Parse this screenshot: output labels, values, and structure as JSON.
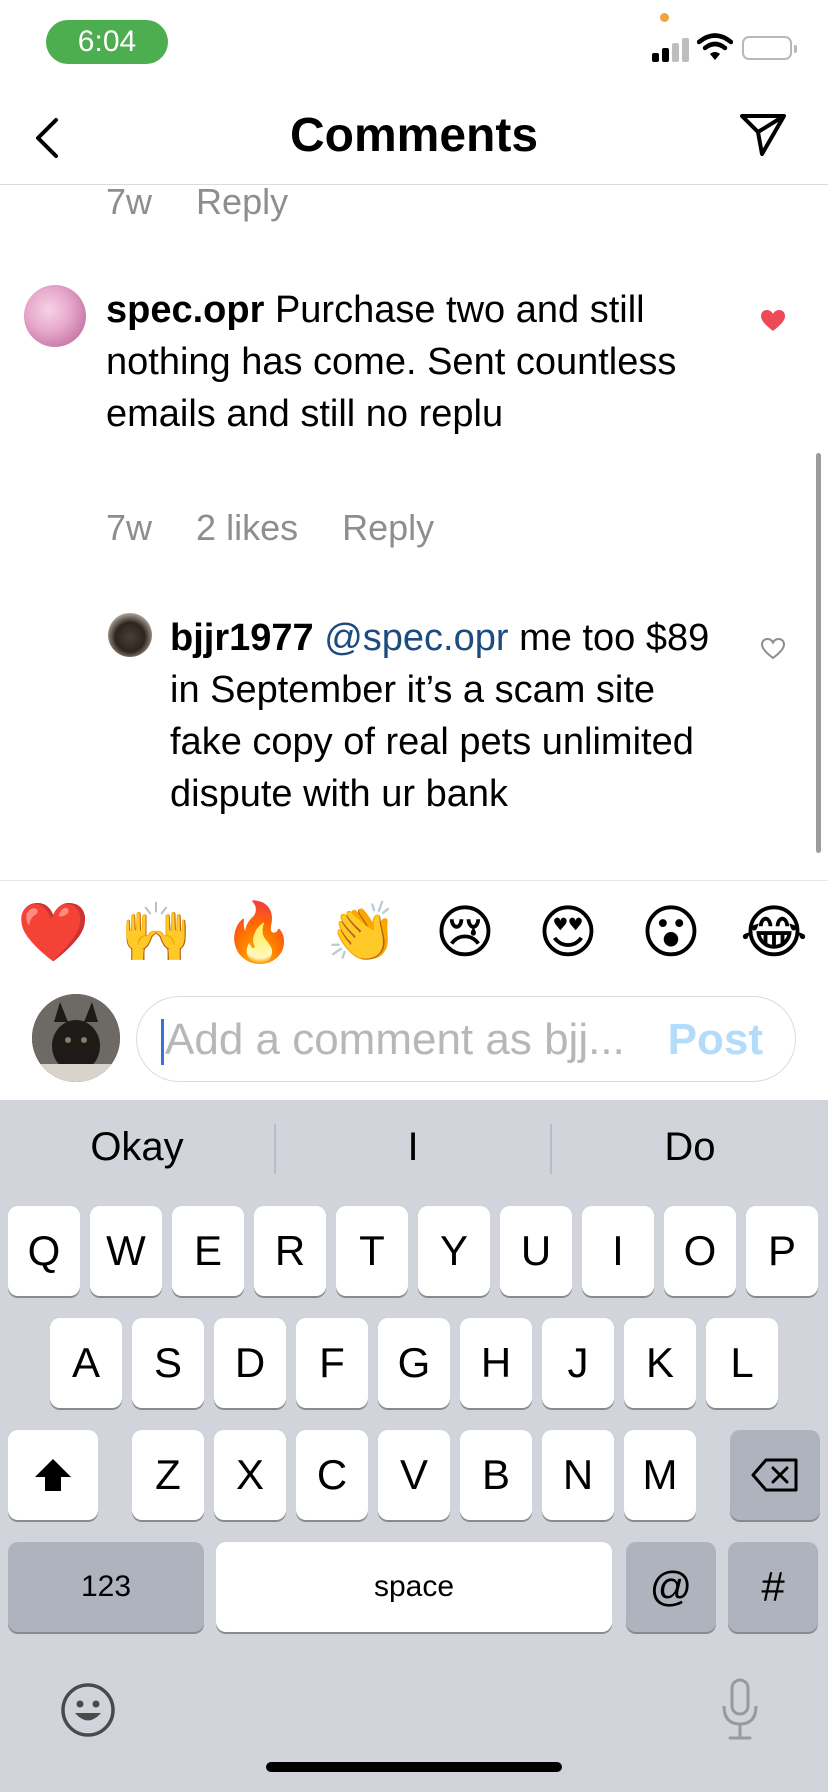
{
  "status_bar": {
    "time": "6:04"
  },
  "header": {
    "title": "Comments"
  },
  "top_meta": {
    "age": "7w",
    "reply": "Reply"
  },
  "comments": [
    {
      "username": "spec.opr",
      "text": "Purchase two and still nothing has come. Sent countless emails and still no replu",
      "age": "7w",
      "likes": "2 likes",
      "reply": "Reply",
      "liked": true
    },
    {
      "username": "bjjr1977",
      "mention": "@spec.opr",
      "text": "me too $89 in September it’s a scam site fake copy of real pets unlimited dispute with ur bank",
      "liked": false
    }
  ],
  "emoji_bar": [
    "❤️",
    "🙌",
    "🔥",
    "👏",
    "😢",
    "😍",
    "😮",
    "😂"
  ],
  "composer": {
    "placeholder": "Add a comment as bjj...",
    "post_label": "Post"
  },
  "keyboard": {
    "suggestions": [
      "Okay",
      "I",
      "Do"
    ],
    "row1": [
      "Q",
      "W",
      "E",
      "R",
      "T",
      "Y",
      "U",
      "I",
      "O",
      "P"
    ],
    "row2": [
      "A",
      "S",
      "D",
      "F",
      "G",
      "H",
      "J",
      "K",
      "L"
    ],
    "row3": [
      "Z",
      "X",
      "C",
      "V",
      "B",
      "N",
      "M"
    ],
    "numbers_label": "123",
    "space_label": "space",
    "at_label": "@",
    "hash_label": "#"
  },
  "colors": {
    "time_pill": "#4cae4f",
    "like_red": "#ed4956",
    "post_disabled": "#b2dcfa",
    "mention_blue": "#1c4b80"
  }
}
